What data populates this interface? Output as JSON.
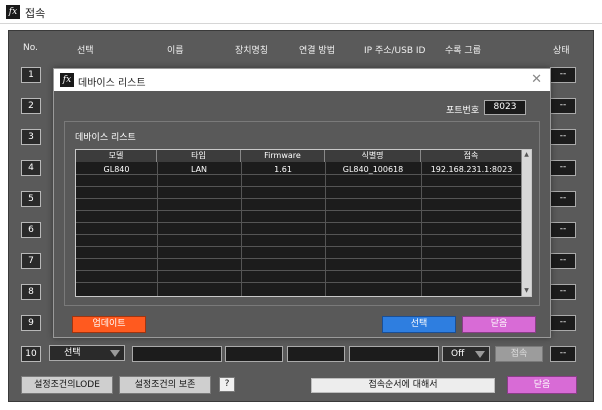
{
  "window": {
    "title": "접속",
    "icon": "app-logo"
  },
  "headers": [
    "No.",
    "선택",
    "이름",
    "장치명칭",
    "연결 방법",
    "IP 주소/USB ID",
    "수록 그룹",
    "상태"
  ],
  "rows": [
    {
      "no": "1",
      "state": "--"
    },
    {
      "no": "2",
      "state": "--"
    },
    {
      "no": "3",
      "state": "--"
    },
    {
      "no": "4",
      "state": "--"
    },
    {
      "no": "5",
      "state": "--"
    },
    {
      "no": "6",
      "state": "--"
    },
    {
      "no": "7",
      "state": "--"
    },
    {
      "no": "8",
      "state": "--"
    },
    {
      "no": "9",
      "state": "--"
    },
    {
      "no": "10",
      "state": "--"
    }
  ],
  "row10": {
    "select_label": "선택",
    "group_value": "Off",
    "connect_label": "접속"
  },
  "bottom": {
    "load_label": "설정조건의LODE",
    "save_label": "설정조건의 보존",
    "help_label": "?",
    "order_label": "접속순서에 대해서",
    "close_label": "닫음"
  },
  "dialog": {
    "title": "데바이스 리스트",
    "port_label": "포트번호",
    "port_value": "8023",
    "group_label": "데바이스 리스트",
    "columns": [
      "모델",
      "타입",
      "Firmware",
      "식별명",
      "접속"
    ],
    "devices": [
      {
        "model": "GL840",
        "type": "LAN",
        "firmware": "1.61",
        "name": "GL840_100618",
        "address": "192.168.231.1:8023"
      }
    ],
    "update_label": "업데이트",
    "select_label": "선택",
    "close_label": "닫음"
  },
  "colors": {
    "pink": "#d86bd6",
    "blue": "#2e7ee0",
    "orange": "#ff5a1f"
  }
}
